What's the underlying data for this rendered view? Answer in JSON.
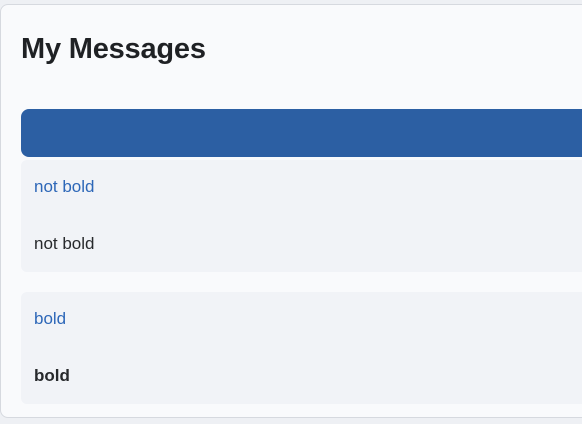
{
  "page": {
    "title": "My Messages"
  },
  "colors": {
    "header_bar": "#2c5fa3",
    "link": "#2d67b8",
    "card_background": "#f1f3f7"
  },
  "messages": [
    {
      "title": "not bold",
      "body": "not bold",
      "body_weight": "normal"
    },
    {
      "title": "bold",
      "body": "bold",
      "body_weight": "bold"
    }
  ]
}
